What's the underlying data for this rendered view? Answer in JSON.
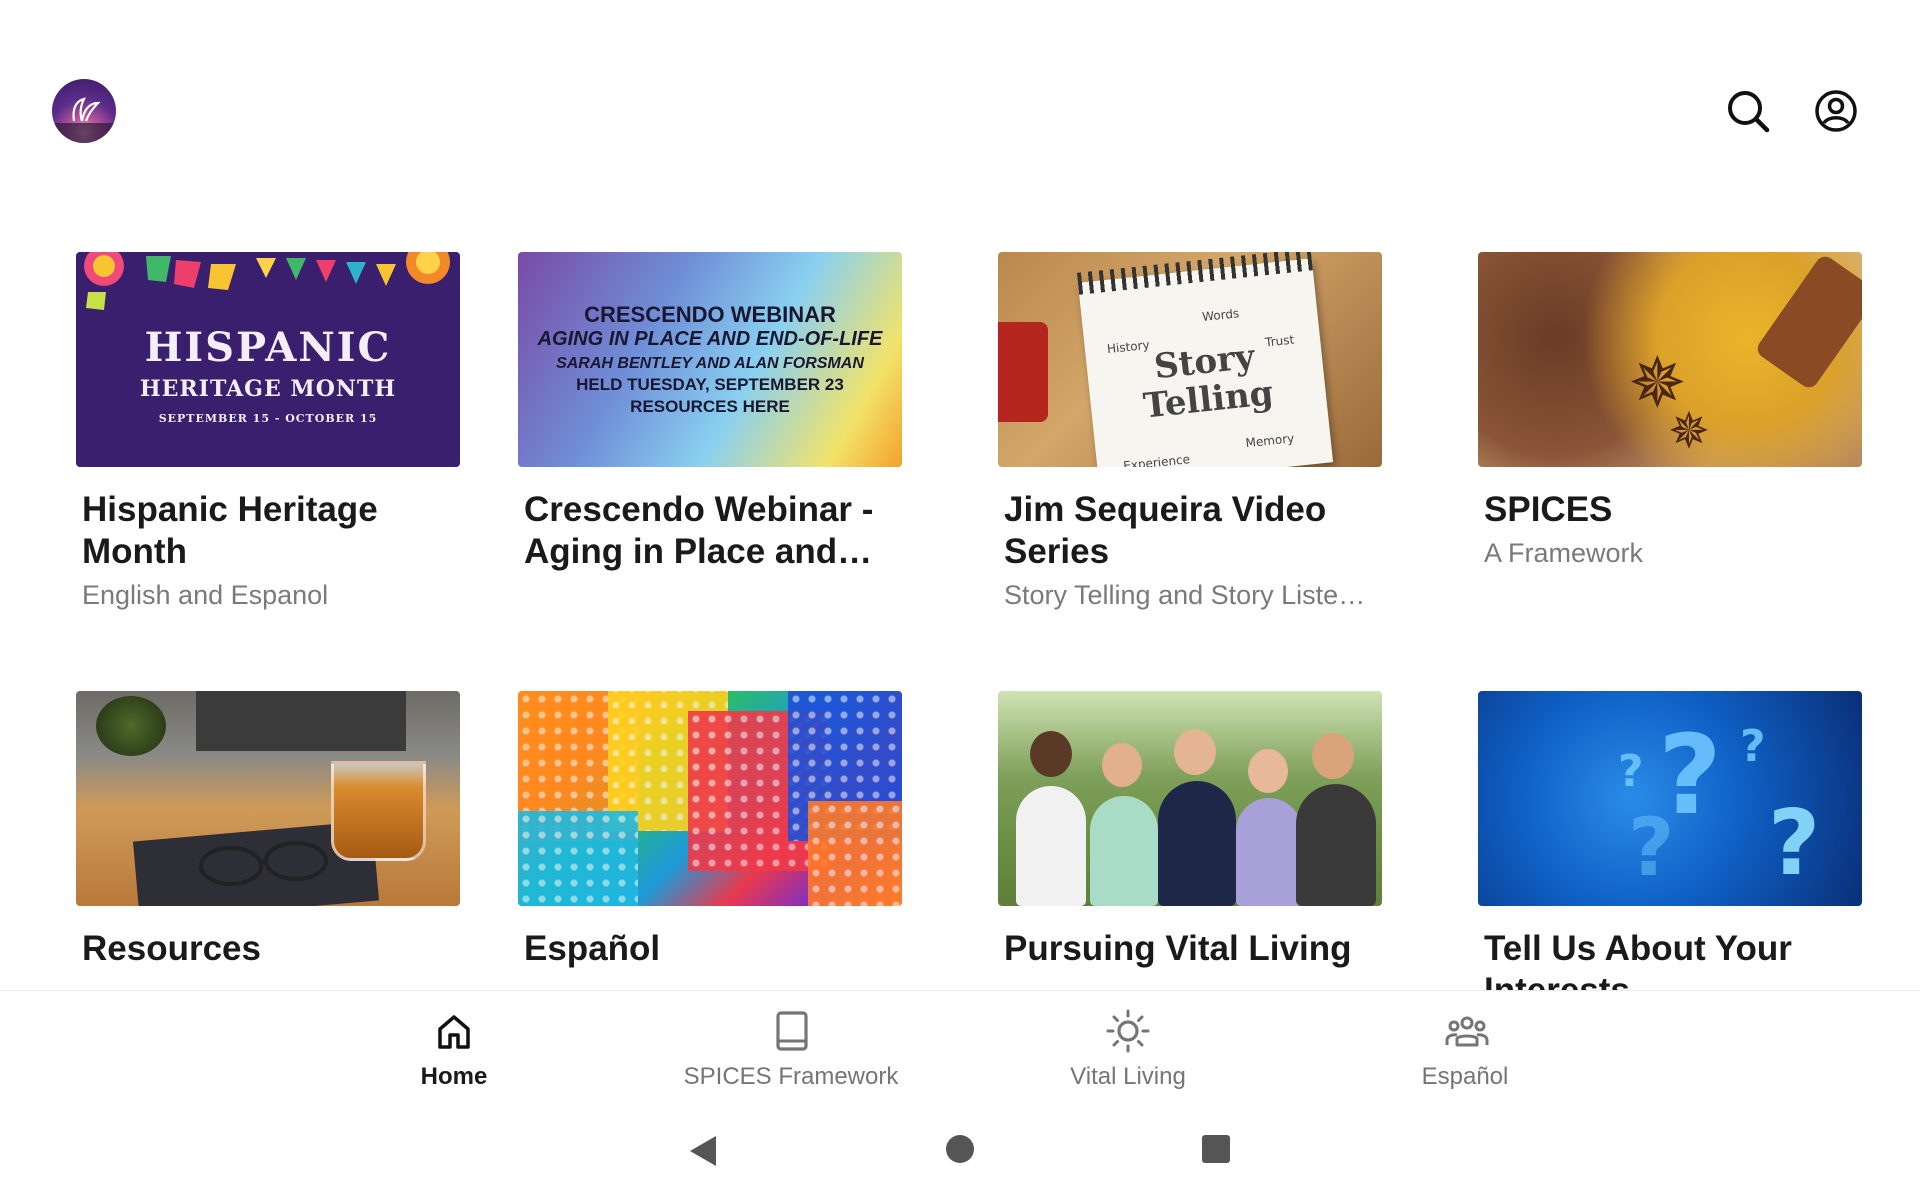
{
  "header": {
    "logo_icon": "app-logo",
    "search_icon": "search-icon",
    "account_icon": "account-circle-icon"
  },
  "cards": [
    {
      "title": "Hispanic Heritage Month",
      "subtitle": "English and Espanol",
      "thumb": {
        "line1": "HISPANIC",
        "line2": "HERITAGE MONTH",
        "line3": "SEPTEMBER 15 - OCTOBER 15"
      }
    },
    {
      "title": "Crescendo Webinar - Aging in Place and End-of-Life",
      "subtitle": "",
      "thumb": {
        "line1": "CRESCENDO WEBINAR",
        "line2": "AGING IN PLACE AND END-OF-LIFE",
        "line3": "SARAH BENTLEY AND ALAN FORSMAN",
        "line4": "HELD TUESDAY, SEPTEMBER 23",
        "line5": "RESOURCES HERE"
      }
    },
    {
      "title": "Jim Sequeira Video Series",
      "subtitle": "Story Telling and Story Listening",
      "thumb": {
        "line1": "Story",
        "line2": "Telling",
        "w1": "History",
        "w2": "Words",
        "w3": "Trust",
        "w4": "Memory",
        "w5": "Experience"
      }
    },
    {
      "title": "SPICES",
      "subtitle": "A Framework",
      "thumb": {}
    },
    {
      "title": "Resources",
      "subtitle": "",
      "thumb": {}
    },
    {
      "title": "Español",
      "subtitle": "",
      "thumb": {}
    },
    {
      "title": "Pursuing Vital Living",
      "subtitle": "",
      "thumb": {}
    },
    {
      "title": "Tell Us About Your Interests",
      "subtitle": "",
      "thumb": {}
    }
  ],
  "bottom_nav": [
    {
      "label": "Home",
      "icon": "home-icon",
      "active": true
    },
    {
      "label": "SPICES Framework",
      "icon": "book-icon",
      "active": false
    },
    {
      "label": "Vital Living",
      "icon": "sun-icon",
      "active": false
    },
    {
      "label": "Español",
      "icon": "groups-icon",
      "active": false
    }
  ],
  "system_nav": {
    "back": "back-icon",
    "home": "home-circle-icon",
    "recents": "recents-square-icon"
  },
  "colors": {
    "active_text": "#1a1a1a",
    "inactive_text": "#757575",
    "subtitle": "#7a7a7a"
  }
}
